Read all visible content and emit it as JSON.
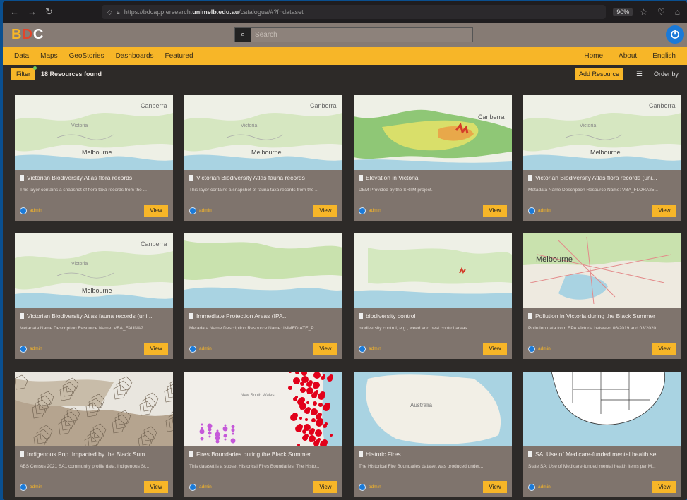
{
  "browser": {
    "url_prefix": "https://bdcapp.ersearch.",
    "url_domain": "unimelb.edu.au",
    "url_path": "/catalogue/#?f=dataset",
    "zoom": "90%"
  },
  "app": {
    "logo": [
      "B",
      "D",
      "C"
    ],
    "search_placeholder": "Search"
  },
  "menu": {
    "left": [
      "Data",
      "Maps",
      "GeoStories",
      "Dashboards",
      "Featured"
    ],
    "right": [
      "Home",
      "About",
      "English"
    ]
  },
  "toolbar": {
    "filter": "Filter",
    "count": "18 Resources found",
    "add": "Add Resource",
    "order": "Order by"
  },
  "cards": [
    {
      "title": "Victorian Biodiversity Atlas flora records",
      "desc": "This layer contains a snapshot of flora taxa records from the ...",
      "owner": "admin",
      "view": "View",
      "map": "vic"
    },
    {
      "title": "Victorian Biodiversity Atlas fauna records",
      "desc": "This layer contains a snapshot of fauna taxa records from the ...",
      "owner": "admin",
      "view": "View",
      "map": "vic"
    },
    {
      "title": "Elevation in Victoria",
      "desc": "DEM Provided by the SRTM project.",
      "owner": "admin",
      "view": "View",
      "map": "elev"
    },
    {
      "title": "Victorian Biodiversity Atlas flora records (uni...",
      "desc": "Metadata Name Description Resource Name: VBA_FLORA25...",
      "owner": "admin",
      "view": "View",
      "map": "vic"
    },
    {
      "title": "Victorian Biodiversity Atlas fauna records (uni...",
      "desc": "Metadata Name Description Resource Name: VBA_FAUNA2...",
      "owner": "admin",
      "view": "View",
      "map": "vic"
    },
    {
      "title": "Immediate Protection Areas (IPA...",
      "desc": "Metadata Name Description Resource Name: IMMEDIATE_P...",
      "owner": "admin",
      "view": "View",
      "map": "ipa"
    },
    {
      "title": "biodiversity control",
      "desc": "biodiversity control, e.g., weed and pest control areas",
      "owner": "admin",
      "view": "View",
      "map": "bio"
    },
    {
      "title": "Pollution in Victoria during the Black Summer",
      "desc": "Pollution data from EPA Victoria between 06/2019 and 03/2020",
      "owner": "admin",
      "view": "View",
      "map": "mel"
    },
    {
      "title": "Indigenous Pop. Impacted by the Black Sum...",
      "desc": "ABS Census 2021 SA1 community profile data. Indigenous St...",
      "owner": "admin",
      "view": "View",
      "map": "indig"
    },
    {
      "title": "Fires Boundaries during the Black Summer",
      "desc": "This dataset is a subset Historical Fires Boundaries. The Histo...",
      "owner": "admin",
      "view": "View",
      "map": "fires"
    },
    {
      "title": "Historic Fires",
      "desc": "The Historical Fire Boundaries dataset was produced under...",
      "owner": "admin",
      "view": "View",
      "map": "aus"
    },
    {
      "title": "SA: Use of Medicare-funded mental health se...",
      "desc": "State SA: Use of Medicare-funded mental health items per M...",
      "owner": "admin",
      "view": "View",
      "map": "sa"
    }
  ],
  "map_labels": {
    "canberra": "Canberra",
    "melbourne": "Melbourne",
    "victoria": "Victoria",
    "new_south_wales": "New South Wales",
    "australia": "Australia"
  },
  "colors": {
    "accent": "#f7b628",
    "header": "#867b74",
    "card": "#7f746d",
    "bg": "#2d2a28"
  }
}
